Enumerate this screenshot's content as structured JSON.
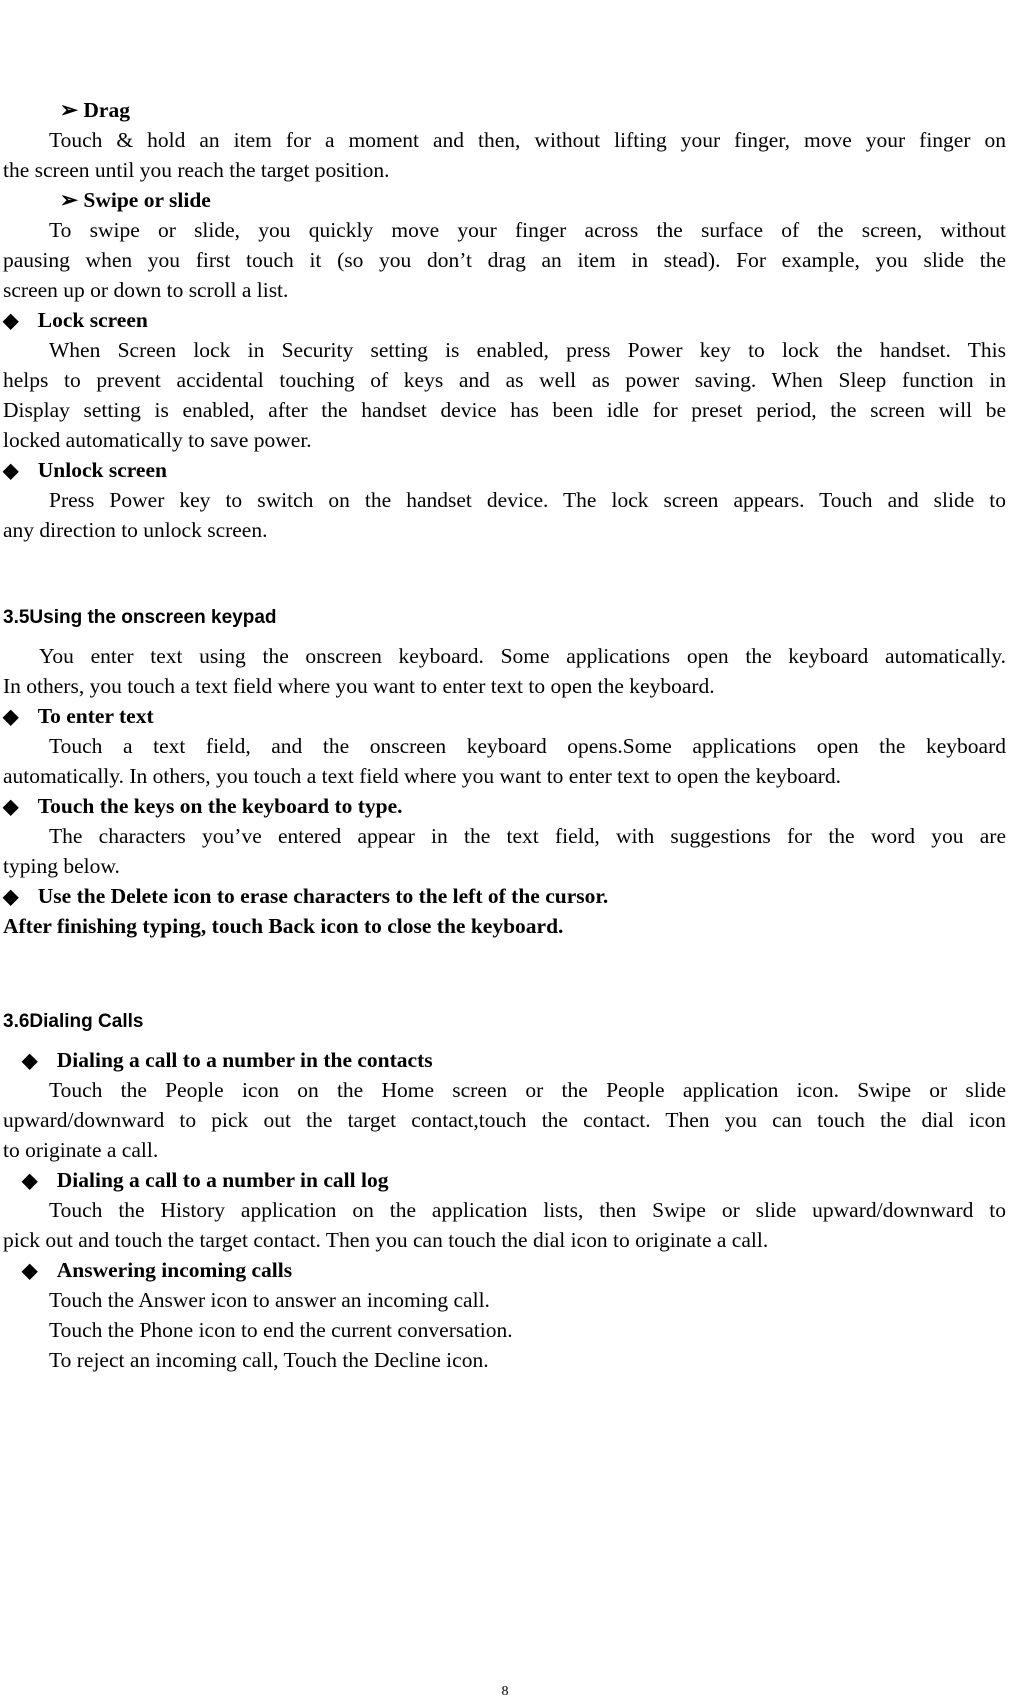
{
  "page": {
    "page_number": "8",
    "icons": {
      "arrow": "➢",
      "diamond": "◆"
    },
    "drag": {
      "heading": "Drag",
      "lines": [
        "Touch & hold an item for a moment and then, without lifting your finger, move your finger on",
        "the screen until you reach the target position."
      ]
    },
    "swipe": {
      "heading": "Swipe or slide",
      "lines": [
        "To swipe or slide, you quickly move your finger across the surface of the screen, without",
        "pausing when you first touch it (so you don’t drag an item in stead). For example, you slide the",
        "screen up or down to scroll a list."
      ]
    },
    "lock_screen": {
      "heading": "Lock screen",
      "lines": [
        "When Screen lock in Security setting is enabled, press Power key to lock the handset. This",
        "helps to prevent accidental touching of keys and as well as power saving.    When Sleep function in",
        "Display setting is enabled, after the handset device has been idle for preset period, the screen will be",
        "locked automatically to save power."
      ]
    },
    "unlock_screen": {
      "heading": "Unlock screen",
      "lines": [
        "Press Power key to switch on the handset device. The lock screen appears. Touch and slide to",
        "any direction to unlock screen."
      ]
    },
    "section_35": {
      "title": "3.5Using the onscreen keypad",
      "intro": [
        "You enter text using the onscreen keyboard. Some applications open the keyboard automatically.",
        "In others, you touch a text field where you want to enter text to open the keyboard."
      ],
      "enter_text": {
        "heading": "To enter text",
        "lines": [
          "Touch a text field, and the onscreen keyboard opens.Some applications open the keyboard",
          "automatically. In others, you touch a text field where you want to enter text to open the keyboard."
        ]
      },
      "touch_keys": {
        "heading": "Touch the keys on the keyboard to type.",
        "lines": [
          "The characters you’ve entered appear in the text field, with suggestions for the word you are",
          "typing below."
        ]
      },
      "delete_heading": "Use the Delete icon to erase characters to the left of the cursor.",
      "after_typing": "After finishing typing, touch Back icon to close the keyboard."
    },
    "section_36": {
      "title": "3.6Dialing Calls",
      "contacts": {
        "heading": "Dialing a call to a number in the contacts",
        "lines": [
          "Touch the People icon on the Home screen or the People application icon. Swipe or slide",
          "upward/downward to pick out the target contact,touch the contact. Then you can touch the dial icon",
          "to originate a call."
        ]
      },
      "call_log": {
        "heading": "Dialing a call to a number in call log",
        "lines": [
          "Touch the History application on the application lists, then Swipe or slide upward/downward to",
          "pick out and touch the target contact. Then you can touch the dial icon to originate a call."
        ]
      },
      "answering": {
        "heading": "Answering incoming calls",
        "lines": [
          "Touch the Answer icon to answer an incoming call.",
          "Touch the Phone icon to end the current conversation.",
          "To reject an incoming call, Touch the Decline icon."
        ]
      }
    }
  }
}
